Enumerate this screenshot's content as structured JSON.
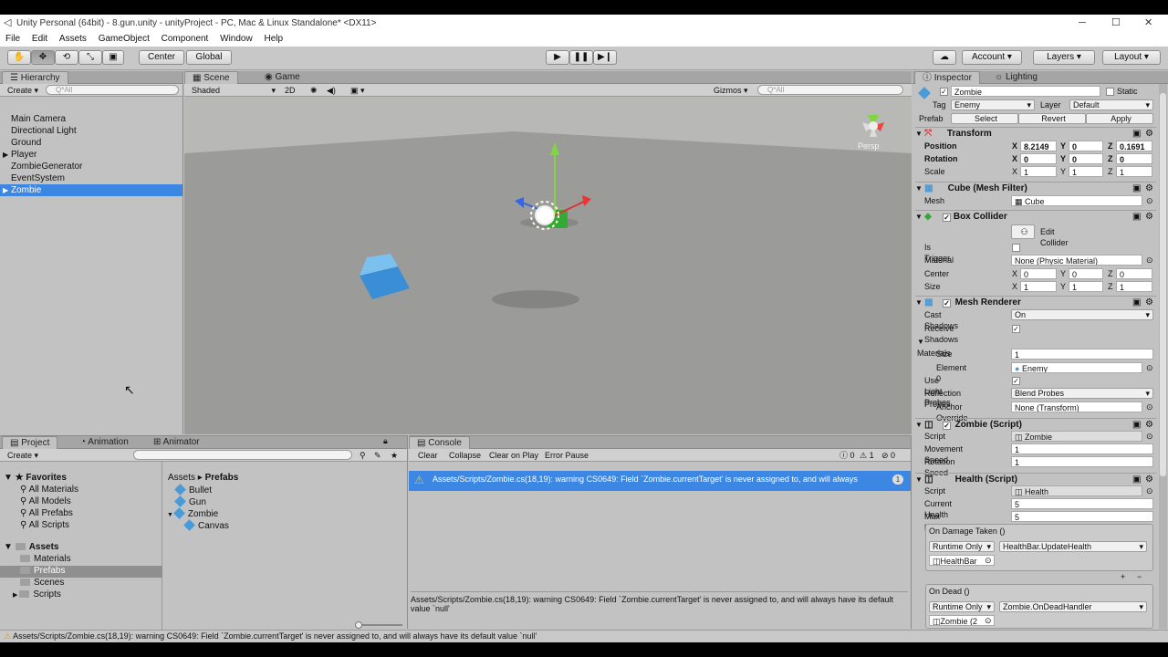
{
  "window": {
    "title": "Unity Personal (64bit) - 8.gun.unity - unityProject - PC, Mac & Linux Standalone* <DX11>"
  },
  "menu": [
    "File",
    "Edit",
    "Assets",
    "GameObject",
    "Component",
    "Window",
    "Help"
  ],
  "toolbar": {
    "center": "Center",
    "global": "Global",
    "account": "Account",
    "layers": "Layers",
    "layout": "Layout"
  },
  "hierarchy": {
    "tab": "Hierarchy",
    "create": "Create",
    "search_placeholder": "Q*All",
    "items": [
      "Main Camera",
      "Directional Light",
      "Ground",
      "Player",
      "ZombieGenerator",
      "EventSystem",
      "Zombie"
    ],
    "selected_index": 6
  },
  "scene": {
    "tab_scene": "Scene",
    "tab_game": "Game",
    "shaded": "Shaded",
    "mode_2d": "2D",
    "gizmos": "Gizmos",
    "search_placeholder": "Q*All",
    "persp": "Persp"
  },
  "project": {
    "tab_project": "Project",
    "tab_animation": "Animation",
    "tab_animator": "Animator",
    "create": "Create",
    "favorites_label": "Favorites",
    "favorites": [
      "All Materials",
      "All Models",
      "All Prefabs",
      "All Scripts"
    ],
    "assets_label": "Assets",
    "assets": [
      "Materials",
      "Prefabs",
      "Scenes",
      "Scripts"
    ],
    "selected_asset": "Prefabs",
    "breadcrumb_root": "Assets",
    "breadcrumb_current": "Prefabs",
    "files": [
      "Bullet",
      "Gun",
      "Zombie",
      "Canvas"
    ]
  },
  "console": {
    "tab": "Console",
    "clear": "Clear",
    "collapse": "Collapse",
    "clear_on_play": "Clear on Play",
    "error_pause": "Error Pause",
    "count_errors": "0",
    "count_warnings": "1",
    "count_logs": "0",
    "message": "Assets/Scripts/Zombie.cs(18,19): warning CS0649: Field `Zombie.currentTarget' is never assigned to, and will always",
    "message_count": "1",
    "detail": "Assets/Scripts/Zombie.cs(18,19): warning CS0649: Field `Zombie.currentTarget' is never assigned to, and will always have its default value `null'"
  },
  "statusbar": {
    "text": "Assets/Scripts/Zombie.cs(18,19): warning CS0649: Field `Zombie.currentTarget' is never assigned to, and will always have its default value `null'"
  },
  "inspector": {
    "tab": "Inspector",
    "tab_lighting": "Lighting",
    "object_name": "Zombie",
    "static_label": "Static",
    "tag_label": "Tag",
    "tag_value": "Enemy",
    "layer_label": "Layer",
    "layer_value": "Default",
    "prefab_label": "Prefab",
    "prefab_select": "Select",
    "prefab_revert": "Revert",
    "prefab_apply": "Apply",
    "transform": {
      "title": "Transform",
      "position_label": "Position",
      "rotation_label": "Rotation",
      "scale_label": "Scale",
      "pos": [
        "8.2149",
        "0",
        "0.1691"
      ],
      "rot": [
        "0",
        "0",
        "0"
      ],
      "scale": [
        "1",
        "1",
        "1"
      ]
    },
    "mesh_filter": {
      "title": "Cube (Mesh Filter)",
      "mesh_label": "Mesh",
      "mesh_value": "Cube"
    },
    "box_collider": {
      "title": "Box Collider",
      "edit_collider": "Edit Collider",
      "is_trigger_label": "Is Trigger",
      "material_label": "Material",
      "material_value": "None (Physic Material)",
      "center_label": "Center",
      "center": [
        "0",
        "0",
        "0"
      ],
      "size_label": "Size",
      "size": [
        "1",
        "1",
        "1"
      ]
    },
    "mesh_renderer": {
      "title": "Mesh Renderer",
      "cast_shadows_label": "Cast Shadows",
      "cast_shadows_value": "On",
      "receive_shadows_label": "Receive Shadows",
      "materials_label": "Materials",
      "size_label": "Size",
      "size_value": "1",
      "element0_label": "Element 0",
      "element0_value": "Enemy",
      "use_light_probes_label": "Use Light Probes",
      "reflection_probes_label": "Reflection Probes",
      "reflection_probes_value": "Blend Probes",
      "anchor_override_label": "Anchor Override",
      "anchor_override_value": "None (Transform)"
    },
    "zombie_script": {
      "title": "Zombie (Script)",
      "script_label": "Script",
      "script_value": "Zombie",
      "movement_speed_label": "Movement Speed",
      "movement_speed_value": "1",
      "rotation_speed_label": "Rotation Speed",
      "rotation_speed_value": "1"
    },
    "health_script": {
      "title": "Health (Script)",
      "script_label": "Script",
      "script_value": "Health",
      "current_health_label": "Current Health",
      "current_health_value": "5",
      "max_health_label": "Max Health",
      "max_health_value": "5",
      "on_damage_label": "On Damage Taken ()",
      "runtime_only": "Runtime Only",
      "damage_handler": "HealthBar.UpdateHealth",
      "damage_target": "HealthBar",
      "on_dead_label": "On Dead ()",
      "dead_handler": "Zombie.OnDeadHandler",
      "dead_target": "Zombie (2"
    }
  },
  "axis": {
    "x": "X",
    "y": "Y",
    "z": "Z"
  }
}
